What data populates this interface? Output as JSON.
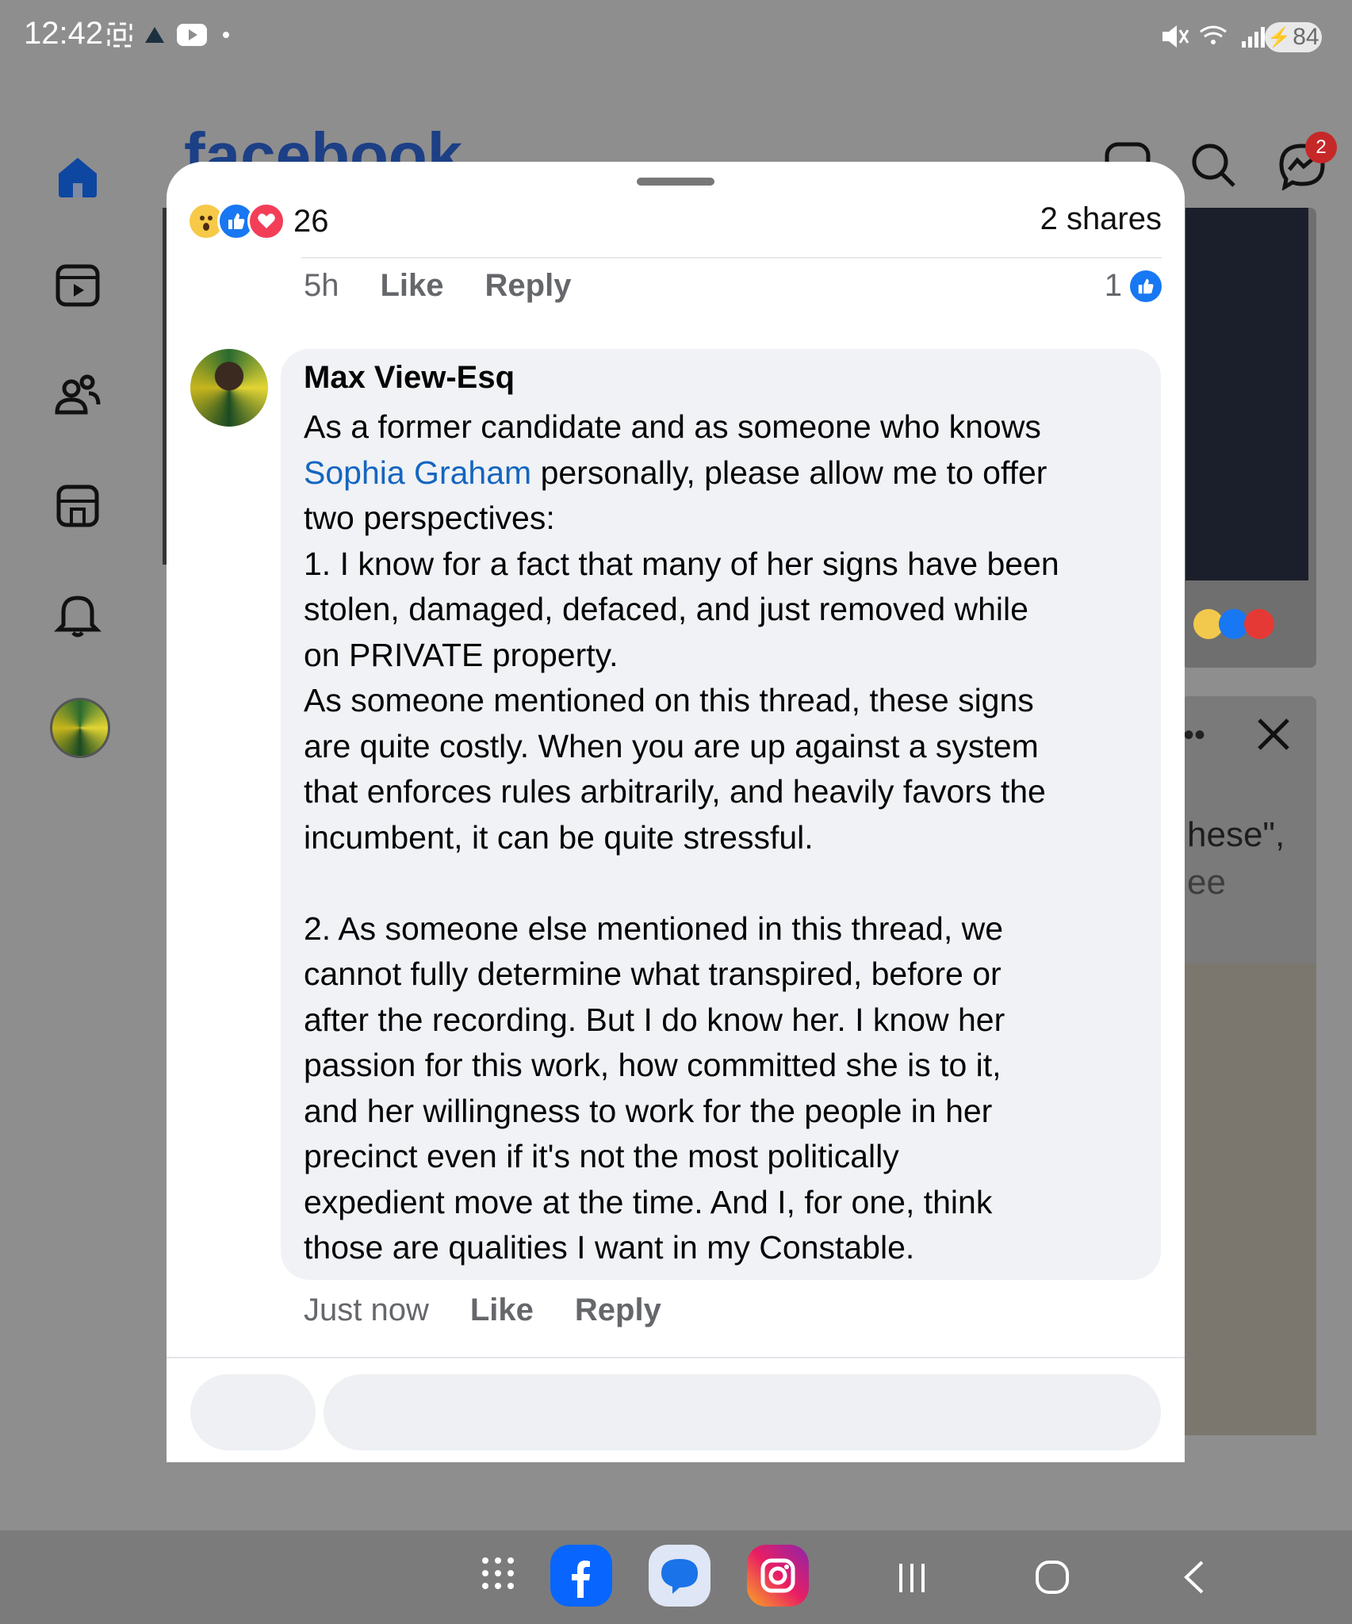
{
  "status_bar": {
    "time": "12:42",
    "battery": "84"
  },
  "background": {
    "logo_text": "facebook",
    "messenger_badge": "2",
    "partial_text_1": "hese\",",
    "partial_text_2": "ee"
  },
  "modal": {
    "reactions": {
      "count": "26",
      "emojis": [
        "wow-icon",
        "like-icon",
        "love-icon"
      ]
    },
    "shares": "2 shares",
    "prev_comment": {
      "time": "5h",
      "like_label": "Like",
      "reply_label": "Reply",
      "like_count": "1"
    },
    "comment": {
      "author": "Max View-Esq",
      "body_start": "As a former candidate and as someone who knows\n",
      "mention": "Sophia Graham",
      "body_rest": " personally, please allow me to offer\ntwo perspectives:\n1. I know for a fact that many of her signs have been\nstolen, damaged, defaced, and just removed while\non PRIVATE property.\nAs someone mentioned on this thread, these signs\nare quite costly. When you are up against a system\nthat enforces rules arbitrarily, and heavily favors the\nincumbent, it can be quite stressful.\n\n2. As someone else mentioned in this thread, we\ncannot fully determine what transpired, before or\nafter the recording. But I do know her. I know her\npassion for this work, how committed she is to it,\nand her willingness to work for the people in her\nprecinct even if it's not the most politically\nexpedient move at the time. And I, for one, think\nthose are qualities I want in my Constable.",
      "time": "Just now",
      "like_label": "Like",
      "reply_label": "Reply"
    }
  },
  "colors": {
    "facebook_blue": "#1877f2",
    "mention_blue": "#1565c0",
    "bubble_bg": "#f0f2f5"
  }
}
